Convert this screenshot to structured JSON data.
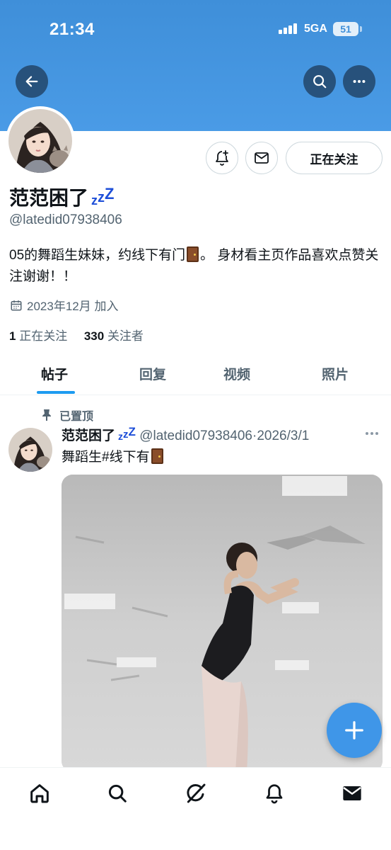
{
  "status_bar": {
    "time": "21:34",
    "network": "5GA",
    "battery": "51"
  },
  "profile": {
    "display_name": "范范困了",
    "handle": "@latedid07938406",
    "bio_before": "05的舞蹈生妹妹，约线下有门",
    "bio_after": "。 身材看主页作品喜欢点赞关注谢谢！！",
    "joined": "2023年12月 加入",
    "following_count": "1",
    "following_label": "正在关注",
    "followers_count": "330",
    "followers_label": "关注者",
    "follow_button_label": "正在关注"
  },
  "tabs": [
    {
      "label": "帖子",
      "active": true
    },
    {
      "label": "回复",
      "active": false
    },
    {
      "label": "视频",
      "active": false
    },
    {
      "label": "照片",
      "active": false
    }
  ],
  "post": {
    "pinned_label": "已置顶",
    "author_name": "范范困了",
    "author_handle": "@latedid07938406",
    "separator": "·",
    "date": "2026/3/1",
    "text": "舞蹈生#线下有"
  },
  "icons": {
    "back": "arrow-left-icon",
    "search": "search-icon",
    "more": "more-horizontal-icon",
    "notify": "bell-plus-icon",
    "message": "envelope-icon",
    "calendar": "calendar-icon",
    "pin": "pin-icon",
    "compose": "plus-icon",
    "nav": [
      "home-icon",
      "search-icon",
      "grok-icon",
      "bell-icon",
      "mail-icon"
    ]
  },
  "colors": {
    "banner": "#4a9be6",
    "accent": "#1d9bf0",
    "fab": "#3f96e8",
    "zzz": "#1d4ed8"
  }
}
